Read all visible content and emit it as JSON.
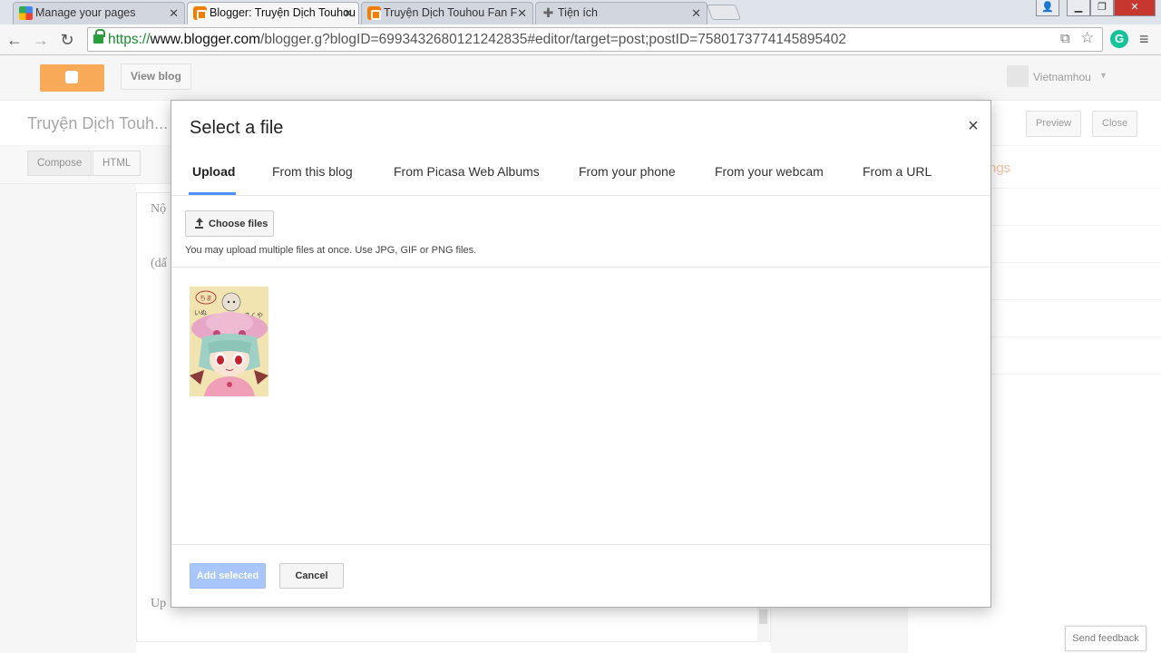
{
  "browser": {
    "tabs": [
      {
        "label": "Manage your pages",
        "icon": "google-icon"
      },
      {
        "label": "Blogger: Truyện Dịch Touhou",
        "icon": "blogger-icon"
      },
      {
        "label": "Truyện Dịch Touhou Fan F",
        "icon": "blogger-icon"
      },
      {
        "label": "Tiện ích",
        "icon": "puzzle-icon"
      }
    ],
    "url": {
      "scheme": "https://",
      "host": "www.blogger.com",
      "path": "/blogger.g?blogID=6993432680121242835#editor/target=post;postID=7580173774145895402"
    }
  },
  "blogger": {
    "view_blog": "View blog",
    "user_name": "Vietnamhou",
    "post_title": "Truyện Dịch Touh...",
    "preview": "Preview",
    "close": "Close",
    "compose": "Compose",
    "html": "HTML",
    "right_title": "ngs",
    "feedback": "Send feedback"
  },
  "dialog": {
    "title": "Select a file",
    "tabs": [
      "Upload",
      "From this blog",
      "From Picasa Web Albums",
      "From your phone",
      "From your webcam",
      "From a URL"
    ],
    "active_tab": "Upload",
    "choose_files": "Choose files",
    "hint": "You may upload multiple files at once. Use JPG, GIF or PNG files.",
    "add_selected": "Add selected",
    "cancel": "Cancel"
  },
  "colors": {
    "accent": "#4d90fe",
    "blogger_orange": "#f57d00",
    "add_disabled": "#a8c6f9"
  }
}
